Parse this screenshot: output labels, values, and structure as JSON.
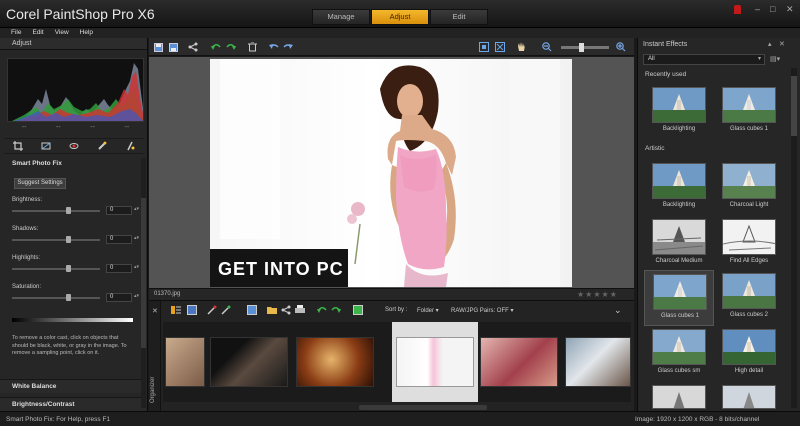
{
  "window": {
    "title": "Corel PaintShop Pro X6",
    "modes": [
      "Manage",
      "Adjust",
      "Edit"
    ],
    "active_mode": "Adjust",
    "controls": {
      "minimize": "–",
      "maximize": "□",
      "close": "✕"
    }
  },
  "menu": [
    "File",
    "Edit",
    "View",
    "Help"
  ],
  "left_panel": {
    "title": "Adjust",
    "hist_labels": [
      "--",
      "--",
      "--",
      "--"
    ],
    "smart_photo_fix": {
      "heading": "Smart Photo Fix",
      "suggest_label": "Suggest Settings",
      "sliders": [
        {
          "label": "Brightness:",
          "value": "0"
        },
        {
          "label": "Shadows:",
          "value": "0"
        },
        {
          "label": "Highlights:",
          "value": "0"
        },
        {
          "label": "Saturation:",
          "value": "0"
        }
      ],
      "help_text": "To remove a color cast, click on objects that should be black, white, or gray in the image. To remove a sampling point, click on it."
    },
    "white_balance": "White Balance",
    "brightness_contrast": "Brightness/Contrast"
  },
  "canvas": {
    "watermark": "GET INTO PC",
    "filename": "01370.jpg",
    "rating": "★★★★★"
  },
  "organizer": {
    "close": "✕",
    "vertical_label": "Organizer",
    "sort_label": "Sort by :",
    "sort_value": "Folder ▾",
    "raw_pairs": "RAW/JPG Pairs: OFF ▾"
  },
  "right_panel": {
    "title": "Instant Effects",
    "category": "All",
    "recently_used_label": "Recently used",
    "artistic_label": "Artistic",
    "recently_used": [
      "Backlighting",
      "Glass cubes 1"
    ],
    "artistic": [
      "Backlighting",
      "Charcoal Light",
      "Charcoal Medium",
      "Find All Edges",
      "Glass cubes 1",
      "Glass cubes 2",
      "Glass cubes sm",
      "High detail"
    ]
  },
  "status": {
    "left": "Smart Photo Fix: For Help, press F1",
    "right": "Image:  1920 x 1200 x RGB - 8 bits/channel"
  },
  "colors": {
    "accent": "#e8a21c",
    "bg": "#262626"
  }
}
